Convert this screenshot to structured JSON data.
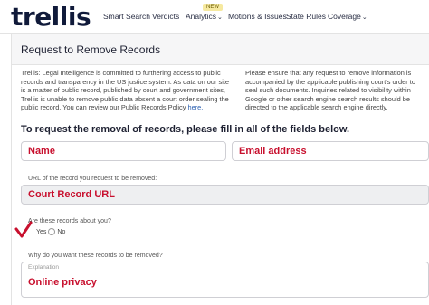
{
  "header": {
    "logo": "trellis",
    "nav": [
      {
        "label": "Smart Search",
        "dropdown": false
      },
      {
        "label": "Verdicts",
        "dropdown": false
      },
      {
        "label": "Analytics",
        "dropdown": true
      },
      {
        "label": "Motions & Issues",
        "dropdown": false
      },
      {
        "label": "State Rules",
        "dropdown": false
      },
      {
        "label": "Coverage",
        "dropdown": true
      }
    ],
    "badge": "NEW"
  },
  "panel": {
    "title": "Request to Remove Records",
    "intro_left": "Trellis: Legal Intelligence is committed to furthering access to public records and transparency in the US justice system. As data on our site is a matter of public record, published by court and government sites, Trellis is unable to remove public data absent a court order sealing the public record. You can review our Public Records Policy",
    "intro_left_link": "here.",
    "intro_right": "Please ensure that any request to remove information is accompanied by the applicable publishing court's order to seal such documents. Inquiries related to visibility within Google or other search engine search results should be directed to the applicable search engine directly.",
    "instruction": "To request the removal of records, please fill in all of the fields below."
  },
  "form": {
    "name_value": "Name",
    "email_value": "Email address",
    "url_label": "URL of the record you request to be removed:",
    "url_value": "Court Record URL",
    "about_label": "Are these records about you?",
    "yes_label": "Yes",
    "no_label": "No",
    "selected": "Yes",
    "why_label": "Why do you want these records to be removed?",
    "explanation_placeholder": "Explanation",
    "explanation_value": "Online privacy"
  },
  "colors": {
    "accent_red": "#c8102e",
    "logo_navy": "#101a3a",
    "link_blue": "#2b5fb0"
  }
}
